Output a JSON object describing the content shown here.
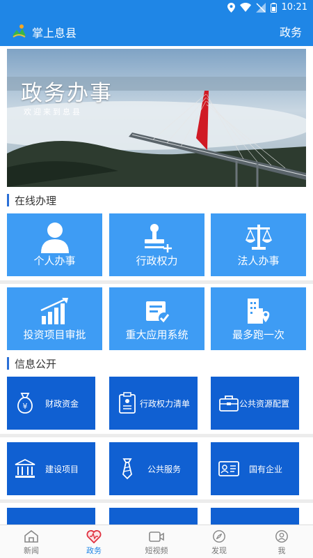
{
  "status_bar": {
    "time": "10:21"
  },
  "app_bar": {
    "title": "掌上息县",
    "right_label": "政务"
  },
  "banner": {
    "headline": "政务办事",
    "subtitle": "欢迎来到息县"
  },
  "section_online": {
    "title": "在线办理",
    "tiles": [
      {
        "label": "个人办事",
        "icon": "person-icon"
      },
      {
        "label": "行政权力",
        "icon": "stamp-icon"
      },
      {
        "label": "法人办事",
        "icon": "scales-icon"
      },
      {
        "label": "投资项目审批",
        "icon": "growth-chart-icon"
      },
      {
        "label": "重大应用系统",
        "icon": "document-check-icon"
      },
      {
        "label": "最多跑一次",
        "icon": "building-location-icon"
      }
    ]
  },
  "section_info": {
    "title": "信息公开",
    "tiles": [
      {
        "label": "财政资金",
        "icon": "money-bag-icon"
      },
      {
        "label": "行政权力清单",
        "icon": "clipboard-list-icon"
      },
      {
        "label": "公共资源配置",
        "icon": "briefcase-icon"
      },
      {
        "label": "建设项目",
        "icon": "government-building-icon"
      },
      {
        "label": "公共服务",
        "icon": "tie-icon"
      },
      {
        "label": "国有企业",
        "icon": "id-card-icon"
      }
    ]
  },
  "tab_bar": {
    "items": [
      {
        "label": "新闻",
        "icon": "home-icon"
      },
      {
        "label": "政务",
        "icon": "heart-icon",
        "active": true
      },
      {
        "label": "短视频",
        "icon": "video-camera-icon"
      },
      {
        "label": "发现",
        "icon": "compass-icon"
      },
      {
        "label": "我",
        "icon": "user-icon"
      }
    ]
  },
  "colors": {
    "primary": "#1f86e6",
    "tile_light": "#3e9cf4",
    "tile_dark": "#1060d2"
  }
}
